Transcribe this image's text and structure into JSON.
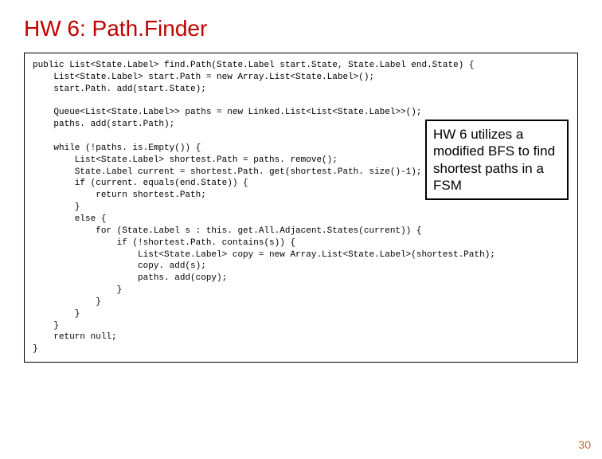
{
  "title": "HW 6: Path.Finder",
  "code": "public List<State.Label> find.Path(State.Label start.State, State.Label end.State) {\n    List<State.Label> start.Path = new Array.List<State.Label>();\n    start.Path. add(start.State);\n\n    Queue<List<State.Label>> paths = new Linked.List<List<State.Label>>();\n    paths. add(start.Path);\n\n    while (!paths. is.Empty()) {\n        List<State.Label> shortest.Path = paths. remove();\n        State.Label current = shortest.Path. get(shortest.Path. size()-1);\n        if (current. equals(end.State)) {\n            return shortest.Path;\n        }\n        else {\n            for (State.Label s : this. get.All.Adjacent.States(current)) {\n                if (!shortest.Path. contains(s)) {\n                    List<State.Label> copy = new Array.List<State.Label>(shortest.Path);\n                    copy. add(s);\n                    paths. add(copy);\n                }\n            }\n        }\n    }\n    return null;\n}",
  "callout": "HW 6 utilizes a modified BFS to find shortest paths in a FSM",
  "page_number": "30"
}
